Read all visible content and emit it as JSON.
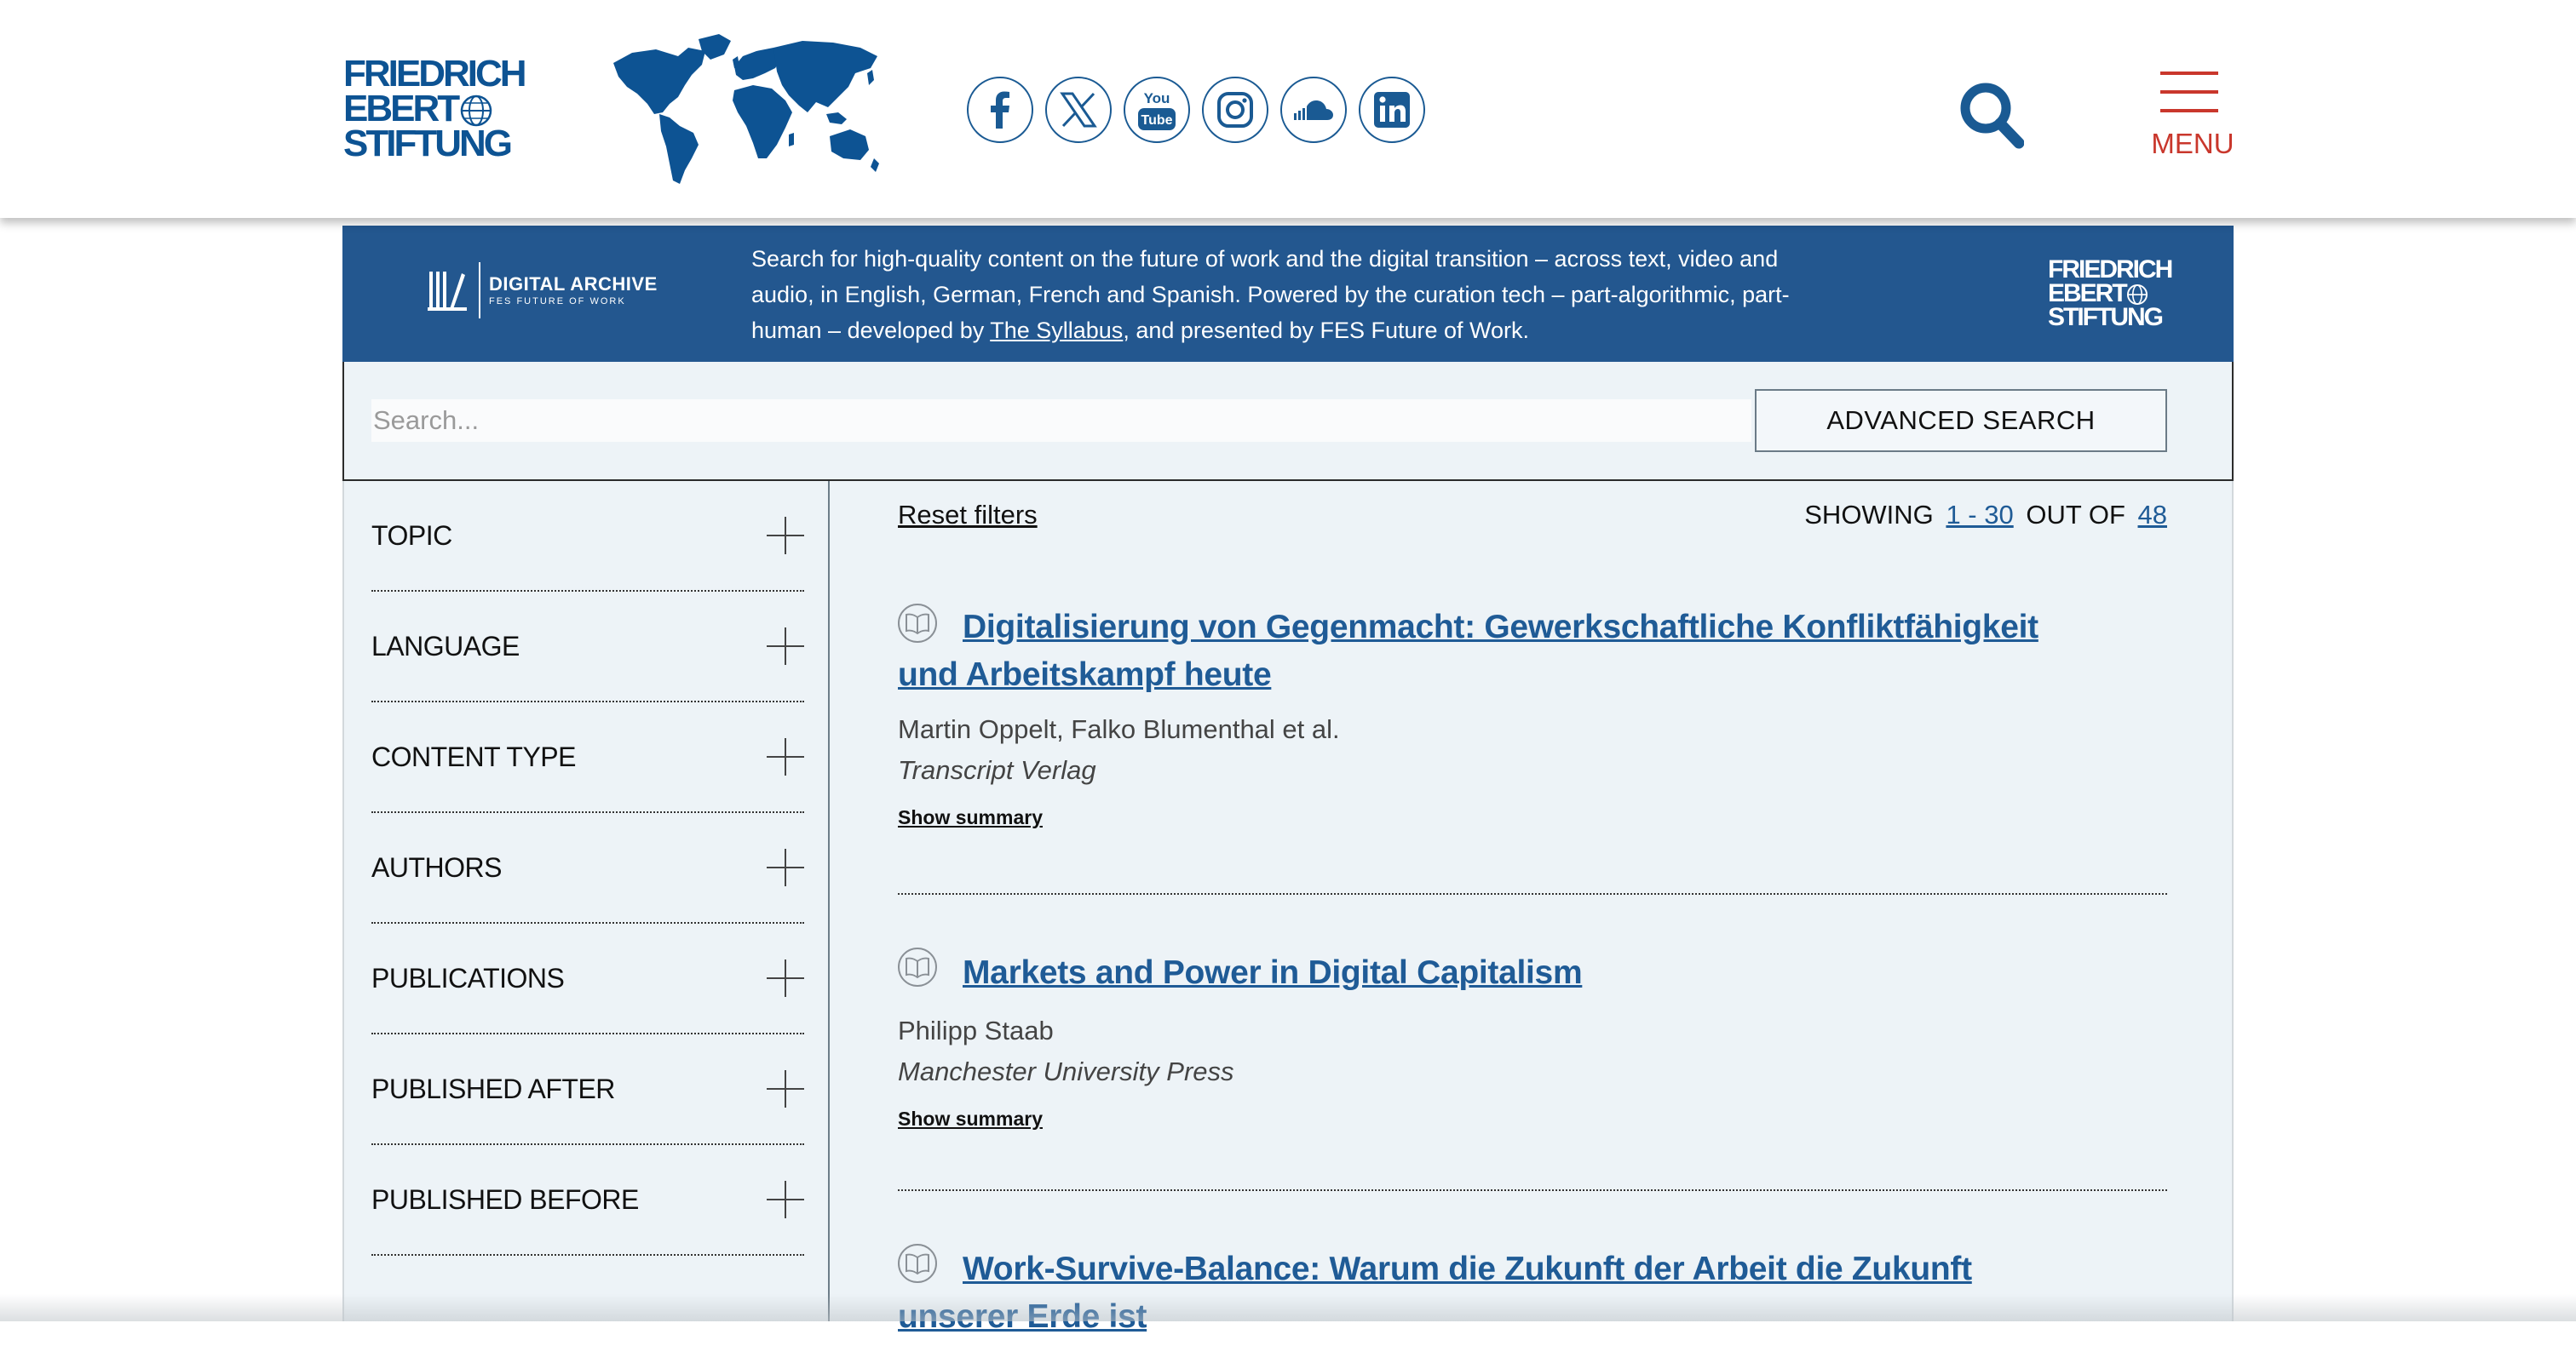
{
  "header": {
    "logo_lines": [
      "FRIEDRICH",
      "EBERT",
      "STIFTUNG"
    ],
    "social_icons": [
      "facebook-icon",
      "x-icon",
      "youtube-icon",
      "instagram-icon",
      "soundcloud-icon",
      "linkedin-icon"
    ],
    "youtube_text": [
      "You",
      "Tube"
    ],
    "menu_label": "MENU"
  },
  "banner": {
    "archive_title": "DIGITAL ARCHIVE",
    "archive_subtitle": "FES FUTURE OF WORK",
    "text_before_link": "Search for high-quality content on the future of work and the digital transition – across text, video and audio, in English, German, French and Spanish. Powered by the curation tech – part-algorithmic, part-human – developed by ",
    "link_text": "The Syllabus",
    "text_after_link": ", and presented by FES Future of Work.",
    "logo_lines": [
      "FRIEDRICH",
      "EBERT",
      "STIFTUNG"
    ]
  },
  "search": {
    "placeholder": "Search...",
    "advanced_label": "ADVANCED SEARCH"
  },
  "facets": [
    "TOPIC",
    "LANGUAGE",
    "CONTENT TYPE",
    "AUTHORS",
    "PUBLICATIONS",
    "PUBLISHED AFTER",
    "PUBLISHED BEFORE"
  ],
  "results_bar": {
    "reset_label": "Reset filters",
    "showing_label": "SHOWING",
    "range": "1 - 30",
    "out_of_label": "OUT OF",
    "total": "48"
  },
  "results": [
    {
      "title": "Digitalisierung von Gegenmacht: Gewerkschaftliche Konfliktfähigkeit und Arbeitskampf heute",
      "authors": "Martin Oppelt, Falko Blumenthal et al.",
      "publisher": "Transcript Verlag",
      "summary_label": "Show summary"
    },
    {
      "title": "Markets and Power in Digital Capitalism",
      "authors": "Philipp Staab",
      "publisher": "Manchester University Press",
      "summary_label": "Show summary"
    },
    {
      "title": "Work-Survive-Balance: Warum die Zukunft der Arbeit die Zukunft unserer Erde ist"
    }
  ],
  "colors": {
    "brand_blue": "#0d5393",
    "banner_blue": "#23578f",
    "link_blue": "#1f5b96",
    "menu_red": "#c9372c",
    "panel_bg": "#edf3f7"
  }
}
